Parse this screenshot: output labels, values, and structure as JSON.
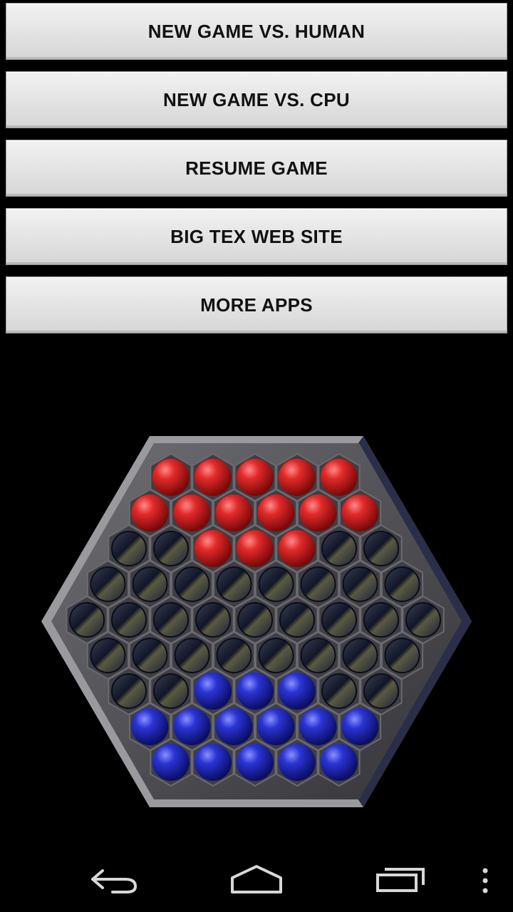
{
  "menu": {
    "buttons": [
      {
        "id": "new-game-vs-human-button",
        "label": "NEW GAME VS. HUMAN"
      },
      {
        "id": "new-game-vs-cpu-button",
        "label": "NEW GAME VS. CPU"
      },
      {
        "id": "resume-game-button",
        "label": "RESUME GAME"
      },
      {
        "id": "big-tex-web-site-button",
        "label": "BIG TEX WEB SITE"
      },
      {
        "id": "more-apps-button",
        "label": "MORE APPS"
      }
    ]
  },
  "board": {
    "rows": [
      {
        "count": 5,
        "cells": "RRRRR"
      },
      {
        "count": 6,
        "cells": "RRRRRR"
      },
      {
        "count": 7,
        "cells": "EERRREE"
      },
      {
        "count": 8,
        "cells": "EEEEEEEE"
      },
      {
        "count": 9,
        "cells": "EEEEEEEEE"
      },
      {
        "count": 8,
        "cells": "EEEEEEEE"
      },
      {
        "count": 7,
        "cells": "EEBBBEE"
      },
      {
        "count": 6,
        "cells": "BBBBBB"
      },
      {
        "count": 5,
        "cells": "BBBBB"
      }
    ],
    "colors": {
      "red": "#d01818",
      "blue": "#1a22b8",
      "empty": "#141a30",
      "frame": "#4a4a4e"
    }
  },
  "navbar": {
    "icons": [
      "back-icon",
      "home-icon",
      "recent-apps-icon",
      "overflow-menu-icon"
    ]
  }
}
